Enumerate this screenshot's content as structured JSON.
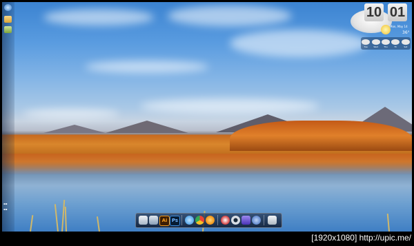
{
  "desktop": {
    "wallpaper": "mountain-lake-autumn",
    "accent": "#4a8fd8"
  },
  "left_sidebar": {
    "items": [
      {
        "icon": "globe-icon"
      },
      {
        "icon": "folder-icon"
      },
      {
        "icon": "gadget-icon"
      }
    ]
  },
  "clock": {
    "hours": "10",
    "minutes": "01"
  },
  "weather": {
    "date": "Mon, May 14",
    "temp": "36°",
    "forecast": [
      {
        "day": "Tue"
      },
      {
        "day": "Wed"
      },
      {
        "day": "Thu"
      },
      {
        "day": "Fri"
      },
      {
        "day": "Sat"
      }
    ]
  },
  "dock": {
    "items": [
      {
        "name": "dock-item-finder",
        "icon": "finder-icon",
        "color": "#cfd8e3"
      },
      {
        "name": "dock-item-documents",
        "icon": "documents-icon",
        "color": "#9fb4c9"
      },
      {
        "name": "dock-item-illustrator",
        "icon": "illustrator-icon",
        "color": "#f29a1c"
      },
      {
        "name": "dock-item-photoshop",
        "icon": "photoshop-icon",
        "color": "#2a6bb8"
      },
      {
        "name": "dock-item-ie",
        "icon": "internet-explorer-icon",
        "color": "#2b8fe0"
      },
      {
        "name": "dock-item-chrome",
        "icon": "chrome-icon",
        "color": "#e94335"
      },
      {
        "name": "dock-item-firefox",
        "icon": "firefox-icon",
        "color": "#f39c1f"
      },
      {
        "name": "dock-item-itunes",
        "icon": "itunes-icon",
        "color": "#d43b3b"
      },
      {
        "name": "dock-item-eye",
        "icon": "eye-icon",
        "color": "#d8dde4"
      },
      {
        "name": "dock-item-media",
        "icon": "media-player-icon",
        "color": "#6a52d6"
      },
      {
        "name": "dock-item-settings",
        "icon": "settings-icon",
        "color": "#4a7bd0"
      },
      {
        "name": "dock-item-trash",
        "icon": "trash-icon",
        "color": "#cfd6dd"
      }
    ],
    "illustrator_label": "Ai",
    "photoshop_label": "Ps"
  },
  "watermark": "[1920x1080] http://upic.me/"
}
